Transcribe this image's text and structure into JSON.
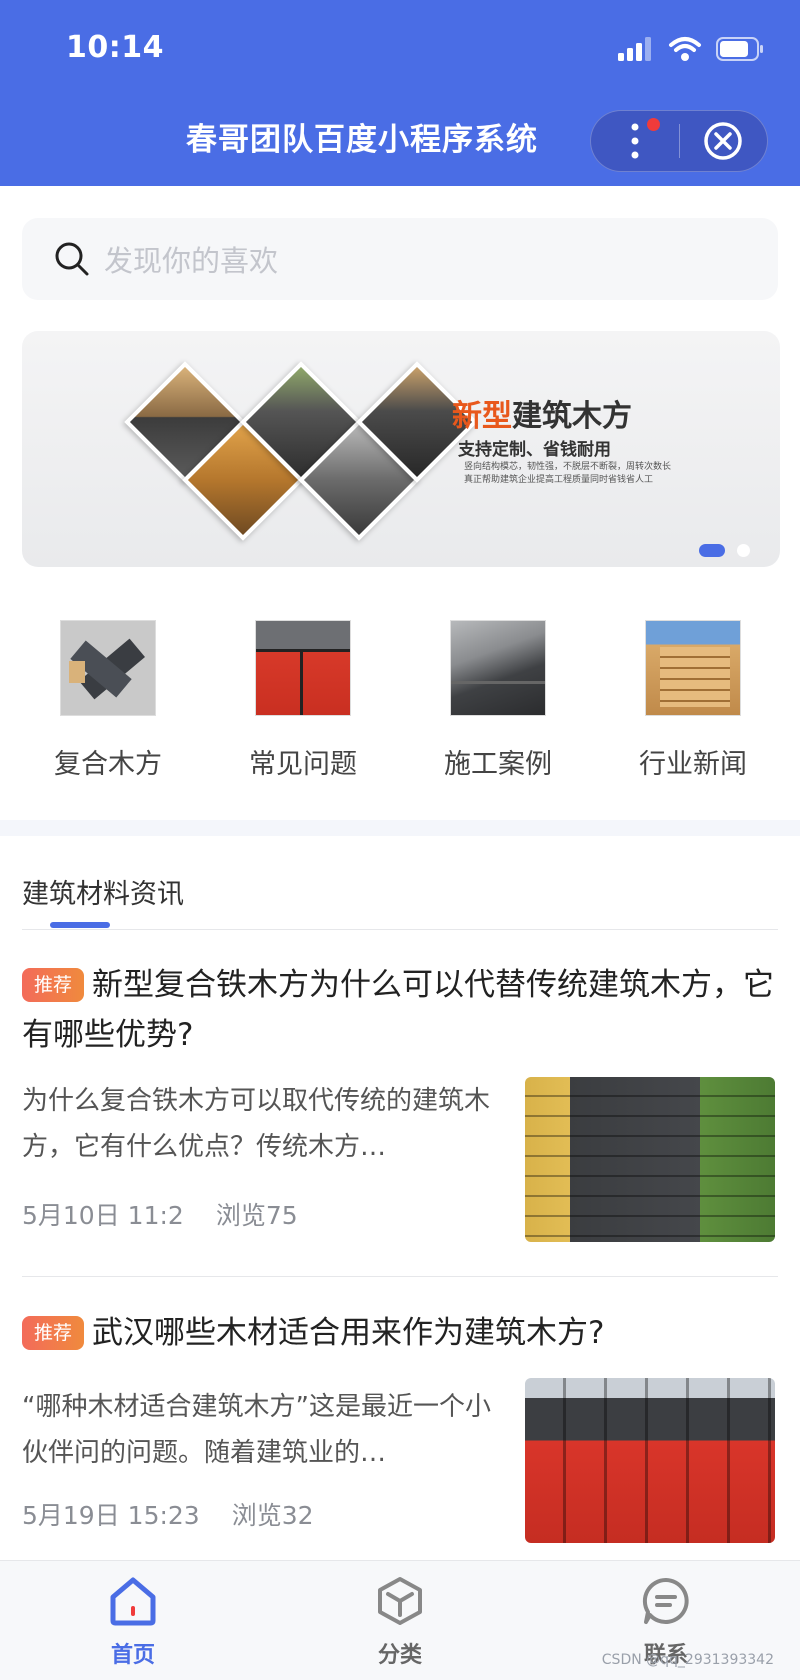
{
  "status_bar": {
    "time": "10:14"
  },
  "nav": {
    "title": "春哥团队百度小程序系统"
  },
  "search": {
    "placeholder": "发现你的喜欢"
  },
  "banner": {
    "title_highlight": "新型",
    "title_rest": "建筑木方",
    "subtitle": "支持定制、省钱耐用",
    "desc_line1": "竖向结构模芯，韧性强，不脱层不断裂，周转次数长",
    "desc_line2": "真正帮助建筑企业提高工程质量同时省钱省人工",
    "slides": 2,
    "active_slide": 1
  },
  "quick_nav": [
    {
      "label": "复合木方",
      "icon": "composite-timber-thumb"
    },
    {
      "label": "常见问题",
      "icon": "faq-thumb"
    },
    {
      "label": "施工案例",
      "icon": "construction-case-thumb"
    },
    {
      "label": "行业新闻",
      "icon": "industry-news-thumb"
    }
  ],
  "news": {
    "tab": "建筑材料资讯",
    "articles": [
      {
        "tag": "推荐",
        "title": "新型复合铁木方为什么可以代替传统建筑木方，它有哪些优势?",
        "summary": "为什么复合铁木方可以取代传统的建筑木方，它有什么优点？传统木方…",
        "date": "5月10日 11:2",
        "views": "浏览75"
      },
      {
        "tag": "推荐",
        "title": "武汉哪些木材适合用来作为建筑木方?",
        "summary": "“哪种木材适合建筑木方”这是最近一个小伙伴问的问题。随着建筑业的…",
        "date": "5月19日 15:23",
        "views": "浏览32"
      }
    ]
  },
  "tabbar": {
    "items": [
      {
        "label": "首页",
        "icon": "home-icon",
        "active": true
      },
      {
        "label": "分类",
        "icon": "category-cube-icon",
        "active": false
      },
      {
        "label": "联系",
        "icon": "contact-chat-icon",
        "active": false
      }
    ]
  },
  "watermark": "CSDN @qq_2931393342",
  "colors": {
    "primary": "#4a6de5",
    "tag_start": "#f36b5a",
    "tag_end": "#f08a3d",
    "badge": "#f03b3b"
  }
}
